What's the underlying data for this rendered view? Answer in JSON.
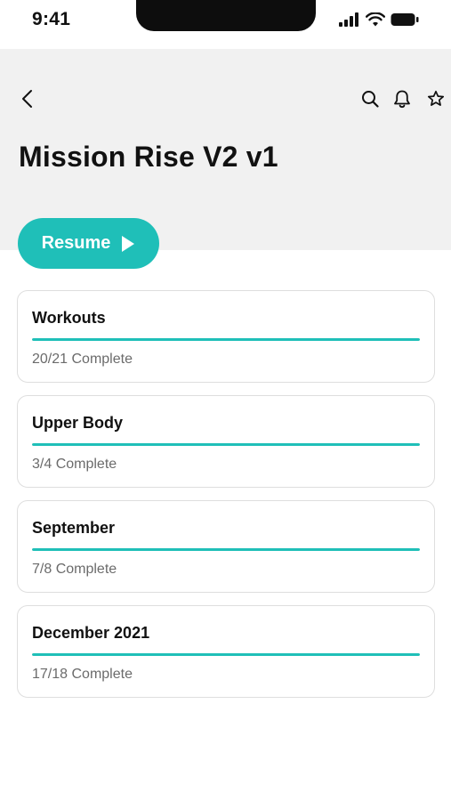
{
  "status_bar": {
    "time": "9:41",
    "icons": [
      "cellular-signal-icon",
      "wifi-icon",
      "battery-icon"
    ]
  },
  "header": {
    "icons": [
      "back-chevron-icon",
      "search-icon",
      "bell-icon",
      "star-icon"
    ],
    "title": "Mission Rise V2 v1"
  },
  "resume": {
    "label": "Resume",
    "icon": "play-icon"
  },
  "colors": {
    "accent": "#1fbfb8",
    "header_background": "#f1f1f1",
    "muted_text": "#6b6b6b",
    "card_border": "#dedede"
  },
  "cards": [
    {
      "title": "Workouts",
      "status": "20/21 Complete",
      "progress": 1.0
    },
    {
      "title": "Upper Body",
      "status": "3/4 Complete",
      "progress": 1.0
    },
    {
      "title": "September",
      "status": "7/8 Complete",
      "progress": 1.0
    },
    {
      "title": "December 2021",
      "status": "17/18 Complete",
      "progress": 1.0
    }
  ]
}
